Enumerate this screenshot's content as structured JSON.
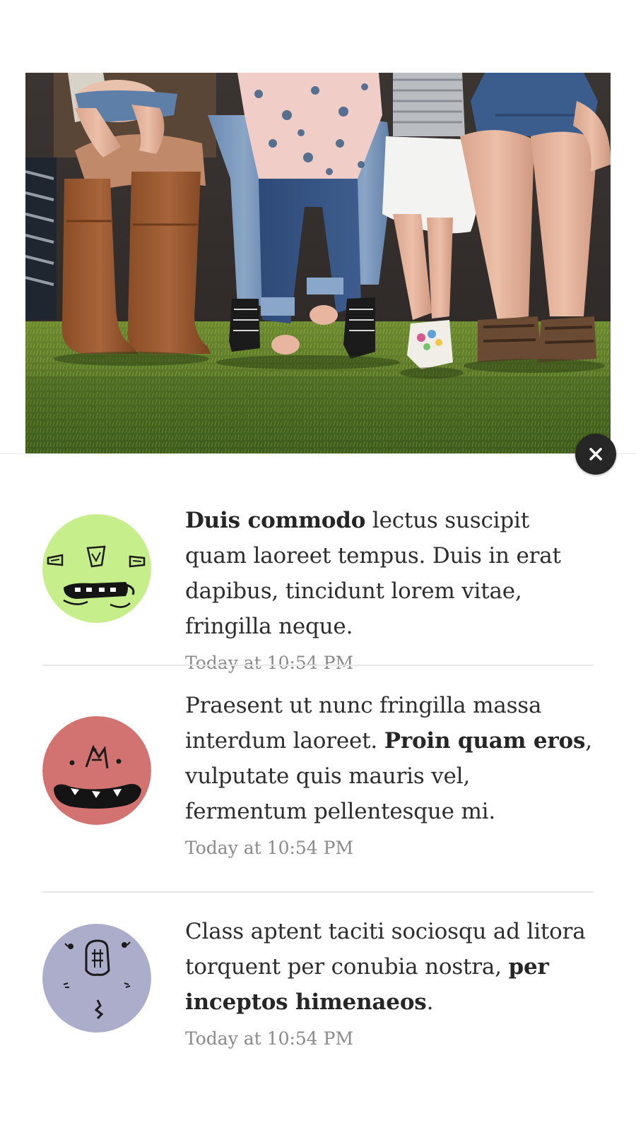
{
  "hero": {
    "image": "family-sitting-on-bench-photo"
  },
  "close": {
    "icon": "close-icon"
  },
  "notifications": [
    {
      "avatar": "green-monster-avatar",
      "avatar_color": "#c6ef8c",
      "text_bold": "Duis commodo",
      "text_after": " lectus suscipit quam laoreet tempus. Duis in erat dapibus, tincidunt lorem vitae, fringilla neque.",
      "time": "Today at 10:54 PM"
    },
    {
      "avatar": "red-monster-avatar",
      "avatar_color": "#d27371",
      "text_before": "Praesent ut nunc fringilla massa interdum laoreet. ",
      "text_bold": "Proin quam eros",
      "text_after": ", vulputate quis mauris vel, fermentum pellentesque mi.",
      "time": "Today at 10:54 PM"
    },
    {
      "avatar": "lavender-monster-avatar",
      "avatar_color": "#abadcb",
      "text_before": "Class aptent taciti sociosqu ad litora torquent per conubia nostra, ",
      "text_bold": "per inceptos himenaeos",
      "text_after": ".",
      "time": "Today at 10:54 PM"
    }
  ]
}
